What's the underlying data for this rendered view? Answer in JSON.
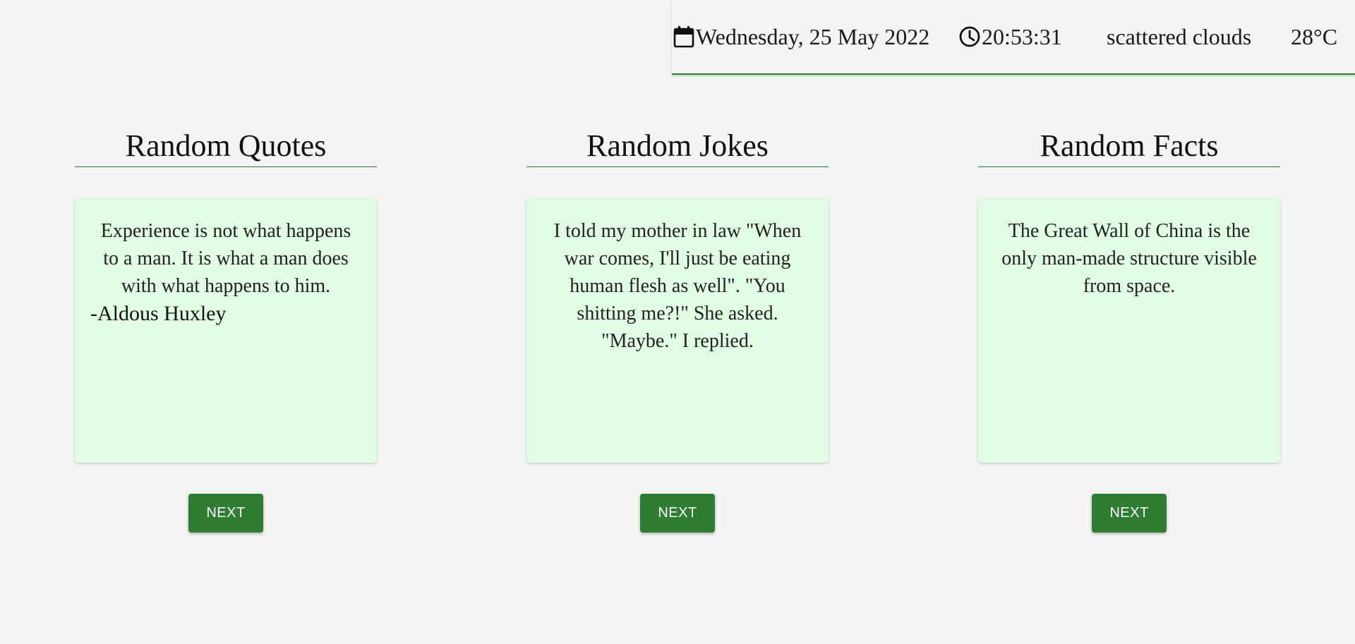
{
  "header": {
    "date": "Wednesday, 25 May 2022",
    "time": "20:53:31",
    "weather": "scattered clouds",
    "temperature": "28°C",
    "icons": {
      "date": "calendar-icon",
      "time": "clock-icon"
    },
    "accent_color": "#2e7d32"
  },
  "columns": [
    {
      "title": "Random Quotes",
      "text": "Experience is not what happens to a man. It is what a man does with what happens to him.",
      "author": "-Aldous Huxley",
      "button": "NEXT"
    },
    {
      "title": "Random Jokes",
      "text": "I told my mother in law \"When war comes, I'll just be eating human flesh as well\". \"You shitting me?!\" She asked. \"Maybe.\" I replied.",
      "button": "NEXT"
    },
    {
      "title": "Random Facts",
      "text": "The Great Wall of China is the only man-made structure visible from space.",
      "button": "NEXT"
    }
  ],
  "colors": {
    "background": "#f3f3f3",
    "card": "#e0fde3",
    "button": "#2e7d32",
    "button_text": "#ffffff"
  }
}
